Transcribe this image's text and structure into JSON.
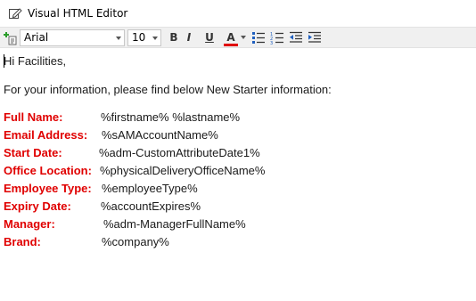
{
  "header": {
    "title": "Visual HTML Editor",
    "icon": "pencil-edit-icon"
  },
  "toolbar": {
    "font_family": "Arial",
    "font_size": "10",
    "bold": "B",
    "italic": "I",
    "underline": "U",
    "font_color_letter": "A",
    "font_color": "#e00000"
  },
  "body": {
    "greeting": "Hi Facilities,",
    "intro": "For your information, please find below New Starter information:",
    "fields": [
      {
        "label": "Full Name:",
        "value": "%firstname% %lastname%"
      },
      {
        "label": "Email Address:",
        "value": "%sAMAccountName%"
      },
      {
        "label": "Start Date:",
        "value": "%adm-CustomAttributeDate1%"
      },
      {
        "label": "Office Location:",
        "value": "%physicalDeliveryOfficeName%"
      },
      {
        "label": "Employee Type:",
        "value": "%employeeType%"
      },
      {
        "label": "Expiry Date:",
        "value": "%accountExpires%"
      },
      {
        "label": "Manager:",
        "value": "%adm-ManagerFullName%"
      },
      {
        "label": "Brand:",
        "value": "%company%"
      }
    ]
  },
  "colors": {
    "label": "#e00000",
    "toolbar_bg": "#f0f0f0"
  }
}
